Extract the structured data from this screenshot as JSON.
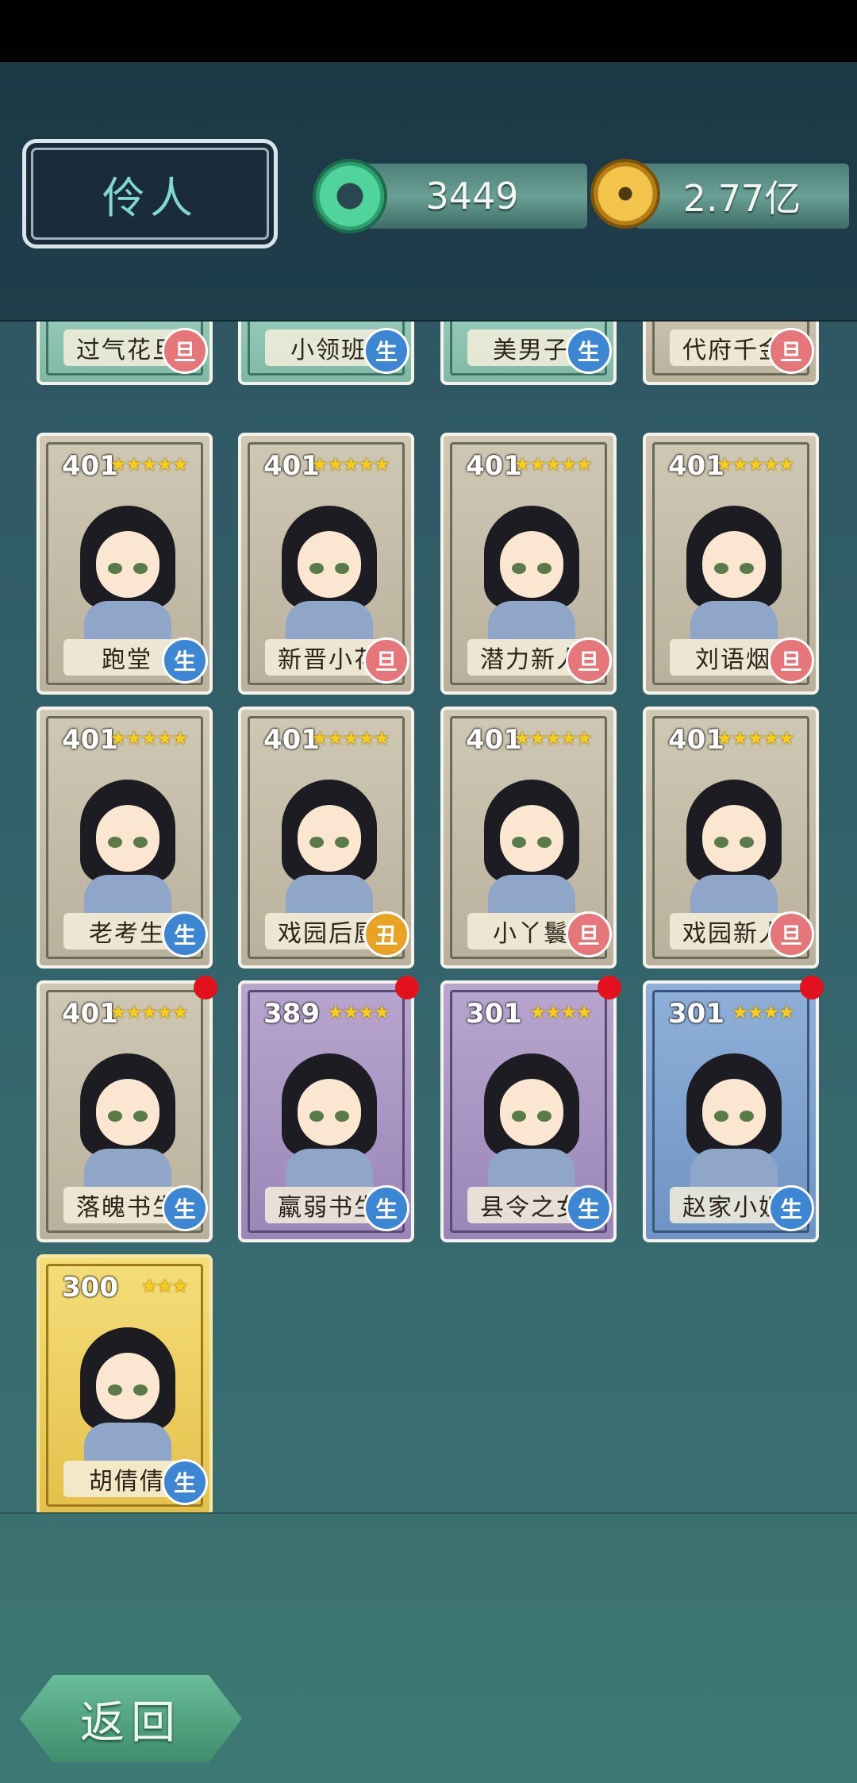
{
  "header": {
    "title": "伶人",
    "jade_count": "3449",
    "coin_count": "2.77亿"
  },
  "partial_row": [
    {
      "name": "过气花旦",
      "type": "旦",
      "type_color": "red",
      "frame": "teal"
    },
    {
      "name": "小领班",
      "type": "生",
      "type_color": "blue",
      "frame": "teal"
    },
    {
      "name": "美男子",
      "type": "生",
      "type_color": "blue",
      "frame": "teal"
    },
    {
      "name": "代府千金",
      "type": "旦",
      "type_color": "red",
      "frame": "grey"
    }
  ],
  "cards": [
    {
      "level": "401",
      "stars": "★★★★★",
      "name": "跑堂",
      "type": "生",
      "type_color": "blue",
      "frame": "grey",
      "new": false
    },
    {
      "level": "401",
      "stars": "★★★★★",
      "name": "新晋小花",
      "type": "旦",
      "type_color": "red",
      "frame": "grey",
      "new": false
    },
    {
      "level": "401",
      "stars": "★★★★★",
      "name": "潜力新人",
      "type": "旦",
      "type_color": "red",
      "frame": "grey",
      "new": false
    },
    {
      "level": "401",
      "stars": "★★★★★",
      "name": "刘语烟",
      "type": "旦",
      "type_color": "red",
      "frame": "grey",
      "new": false
    },
    {
      "level": "401",
      "stars": "★★★★★",
      "name": "老考生",
      "type": "生",
      "type_color": "blue",
      "frame": "grey",
      "new": false
    },
    {
      "level": "401",
      "stars": "★★★★★",
      "name": "戏园后厨",
      "type": "丑",
      "type_color": "orange",
      "frame": "grey",
      "new": false
    },
    {
      "level": "401",
      "stars": "★★★★★",
      "name": "小丫鬟",
      "type": "旦",
      "type_color": "red",
      "frame": "grey",
      "new": false
    },
    {
      "level": "401",
      "stars": "★★★★★",
      "name": "戏园新人",
      "type": "旦",
      "type_color": "red",
      "frame": "grey",
      "new": false
    },
    {
      "level": "401",
      "stars": "★★★★★",
      "name": "落魄书生",
      "type": "生",
      "type_color": "blue",
      "frame": "grey",
      "new": true
    },
    {
      "level": "389",
      "stars": "★★★★",
      "name": "羸弱书生",
      "type": "生",
      "type_color": "blue",
      "frame": "purple",
      "new": true
    },
    {
      "level": "301",
      "stars": "★★★★",
      "name": "县令之女",
      "type": "生",
      "type_color": "blue",
      "frame": "purple",
      "new": true
    },
    {
      "level": "301",
      "stars": "★★★★",
      "name": "赵家小姐",
      "type": "生",
      "type_color": "blue",
      "frame": "blue",
      "new": true
    },
    {
      "level": "300",
      "stars": "★★★",
      "name": "胡倩倩",
      "type": "生",
      "type_color": "blue",
      "frame": "gold",
      "new": false
    }
  ],
  "footer": {
    "back_label": "返回"
  },
  "colors": {
    "header_bg": "#1c3845",
    "grid_bg": "#2e5763",
    "star": "#f7cd1d",
    "badge_blue": "#3d86d4",
    "badge_red": "#e5767a",
    "badge_orange": "#e8a224",
    "new_dot": "#e1121d"
  }
}
